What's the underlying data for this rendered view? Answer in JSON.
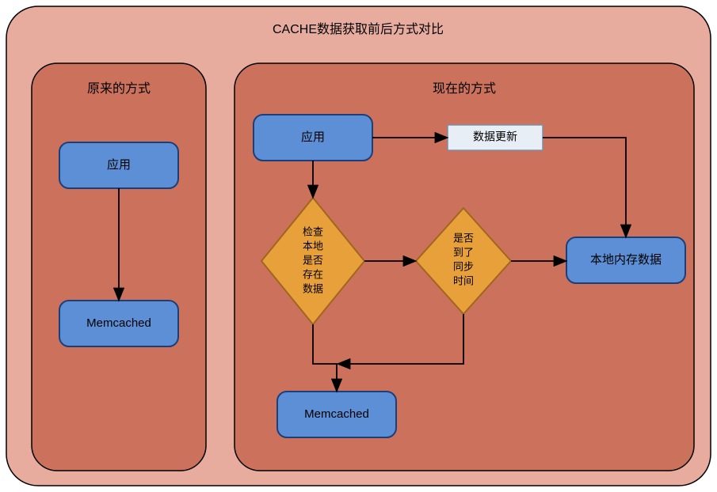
{
  "title": "CACHE数据获取前后方式对比",
  "left_panel": {
    "title": "原来的方式",
    "nodes": {
      "app": "应用",
      "memcached": "Memcached"
    }
  },
  "right_panel": {
    "title": "现在的方式",
    "nodes": {
      "app": "应用",
      "data_update": "数据更新",
      "check_local": [
        "检查",
        "本地",
        "是否",
        "存在",
        "数据"
      ],
      "check_sync": [
        "是否",
        "到了",
        "同步",
        "时间"
      ],
      "local_mem": "本地内存数据",
      "memcached": "Memcached"
    }
  },
  "colors": {
    "outer_bg": "#e8ac9f",
    "panel_bg": "#cc725c",
    "stroke": "#000000",
    "blue_fill": "#5c8fd6",
    "blue_stroke": "#1c3f7a",
    "orange_fill": "#e8a03a",
    "orange_stroke": "#a0661e",
    "light_fill": "#e8eef5",
    "light_stroke": "#7a8fa8"
  }
}
